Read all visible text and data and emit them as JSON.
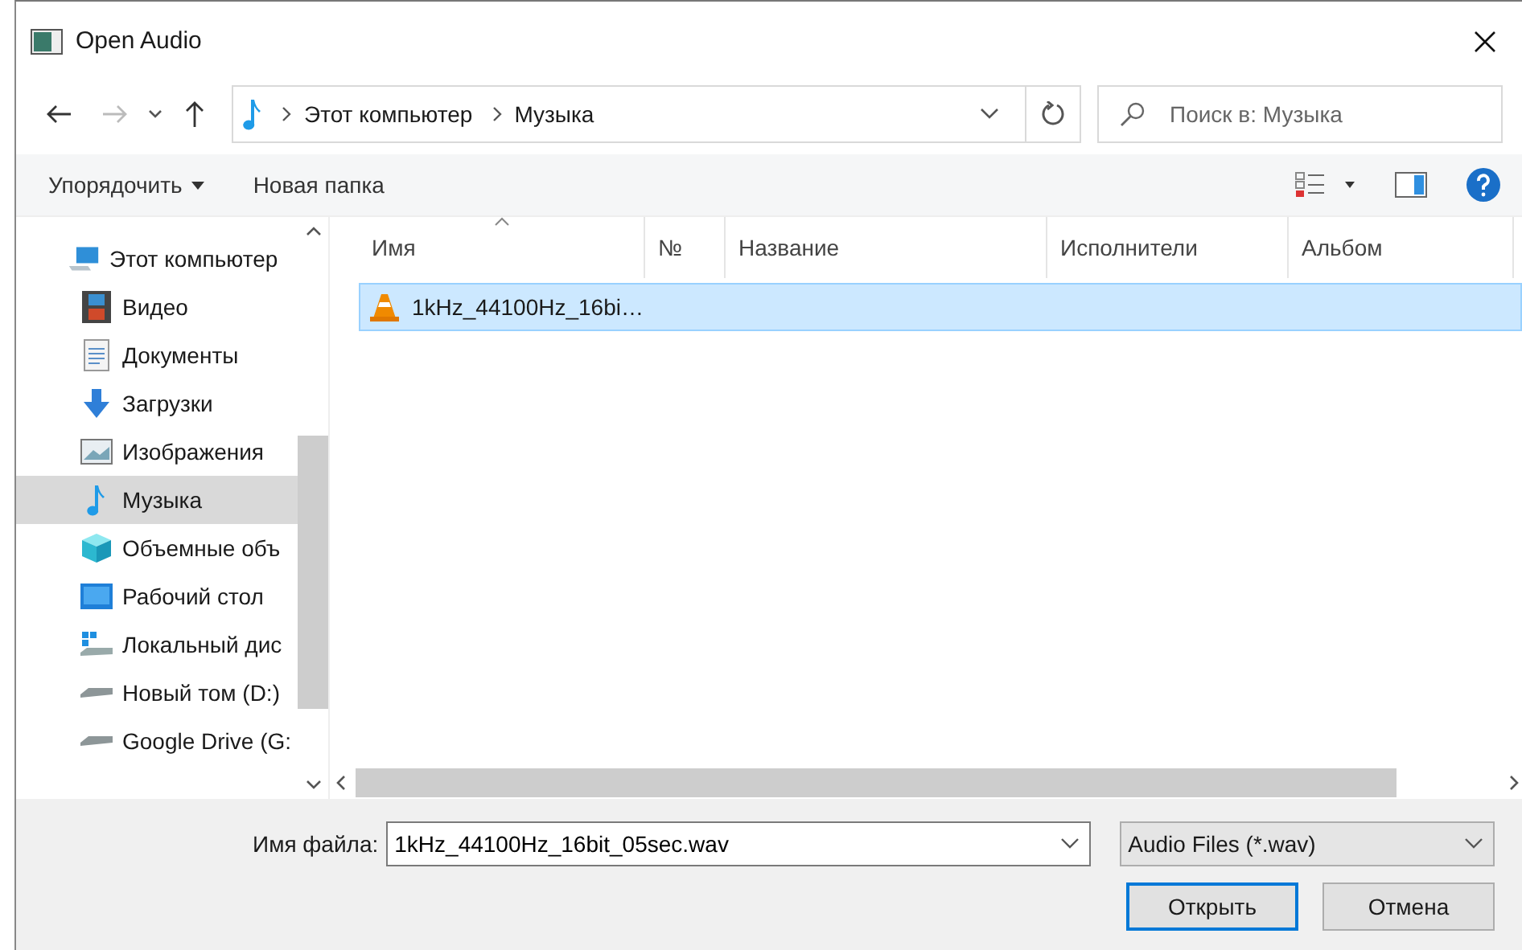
{
  "window": {
    "title": "Open Audio"
  },
  "address": {
    "crumbs": [
      "Этот компьютер",
      "Музыка"
    ]
  },
  "search": {
    "placeholder": "Поиск в: Музыка"
  },
  "toolbar": {
    "organize": "Упорядочить",
    "new_folder": "Новая папка"
  },
  "sidebar": {
    "items": [
      {
        "label": "Этот компьютер",
        "kind": "computer",
        "selected": false,
        "children": [
          {
            "label": "Видео",
            "kind": "video",
            "selected": false
          },
          {
            "label": "Документы",
            "kind": "documents",
            "selected": false
          },
          {
            "label": "Загрузки",
            "kind": "downloads",
            "selected": false
          },
          {
            "label": "Изображения",
            "kind": "pictures",
            "selected": false
          },
          {
            "label": "Музыка",
            "kind": "music",
            "selected": true
          },
          {
            "label": "Объемные объ",
            "kind": "objects",
            "selected": false
          },
          {
            "label": "Рабочий стол",
            "kind": "desktop",
            "selected": false
          },
          {
            "label": "Локальный дис",
            "kind": "system-drive",
            "selected": false
          },
          {
            "label": "Новый том (D:)",
            "kind": "drive",
            "selected": false
          },
          {
            "label": "Google Drive (G:",
            "kind": "drive",
            "selected": false
          }
        ]
      }
    ]
  },
  "columns": [
    {
      "label": "Имя",
      "sorted": true
    },
    {
      "label": "№",
      "sorted": false
    },
    {
      "label": "Название",
      "sorted": false
    },
    {
      "label": "Исполнители",
      "sorted": false
    },
    {
      "label": "Альбом",
      "sorted": false
    }
  ],
  "files": [
    {
      "name": "1kHz_44100Hz_16bi…",
      "selected": true
    }
  ],
  "filename": {
    "label": "Имя файла:",
    "value": "1kHz_44100Hz_16bit_05sec.wav"
  },
  "filter": {
    "value": "Audio Files (*.wav)"
  },
  "buttons": [
    {
      "label": "Открыть",
      "default": true
    },
    {
      "label": "Отмена",
      "default": false
    }
  ]
}
